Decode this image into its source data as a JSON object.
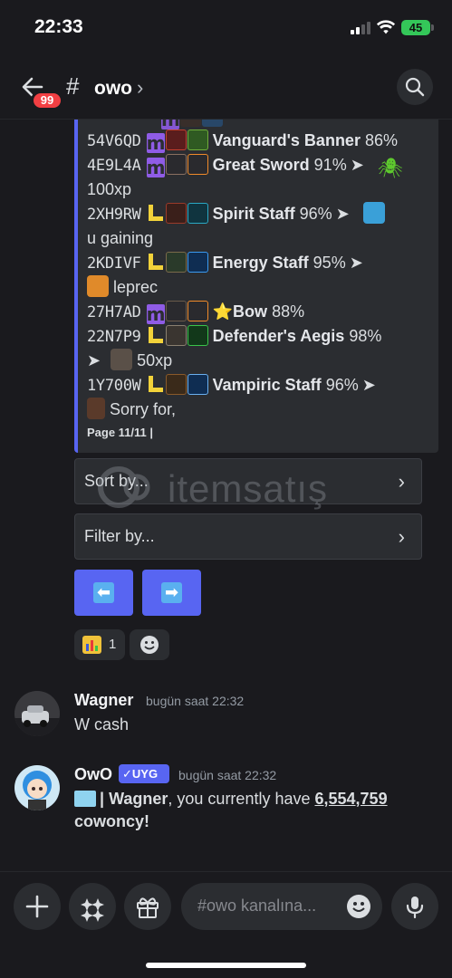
{
  "status": {
    "time": "22:33",
    "battery": "45"
  },
  "header": {
    "unread_badge": "99",
    "hash": "#",
    "channel": "owo",
    "chevron": "›"
  },
  "inventory": {
    "rows": [
      {
        "id": "54V6QD",
        "name": "Vanguard's Banner",
        "pct": "86%",
        "tier": "M"
      },
      {
        "id": "4E9L4A",
        "name": "Great Sword",
        "pct": "91%",
        "tier": "M",
        "arrow": "➤",
        "tail": "100xp"
      },
      {
        "id": "2XH9RW",
        "name": "Spirit Staff",
        "pct": "96%",
        "tier": "L",
        "arrow": "➤",
        "tail": "u gaining"
      },
      {
        "id": "2KDIVF",
        "name": "Energy Staff",
        "pct": "95%",
        "tier": "L",
        "arrow": "➤",
        "tail": "leprec"
      },
      {
        "id": "27H7AD",
        "name": "Bow",
        "pct": "88%",
        "tier": "M",
        "star": "⭐"
      },
      {
        "id": "22N7P9",
        "name": "Defender's Aegis",
        "pct": "98%",
        "tier": "L",
        "arrow": "➤",
        "tail": "50xp"
      },
      {
        "id": "1Y700W",
        "name": "Vampiric Staff",
        "pct": "96%",
        "tier": "L",
        "arrow": "➤",
        "tail": "Sorry for,"
      }
    ],
    "footer": "Page 11/11 |"
  },
  "controls": {
    "sort_label": "Sort by...",
    "filter_label": "Filter by...",
    "chevron": "›",
    "prev": "⬅",
    "next": "➡"
  },
  "watermark": "itemsatış",
  "reactions": {
    "chart_count": "1"
  },
  "messages": [
    {
      "author": "Wagner",
      "time": "bugün saat 22:32",
      "text": "W cash"
    },
    {
      "author": "OwO",
      "tag": "✓UYG",
      "time": "bugün saat 22:32",
      "sep": "|",
      "user": "Wagner",
      "text_mid": ", you currently have",
      "amount": "6,554,759",
      "text_end": "cowoncy!"
    }
  ],
  "composer": {
    "placeholder": "#owo kanalına..."
  },
  "colors": {
    "blurple": "#5865f2",
    "embed_bg": "#2b2d31",
    "bg": "#1a1a1e",
    "tier_m": "#8f5ce6",
    "tier_l": "#f2d23a"
  }
}
